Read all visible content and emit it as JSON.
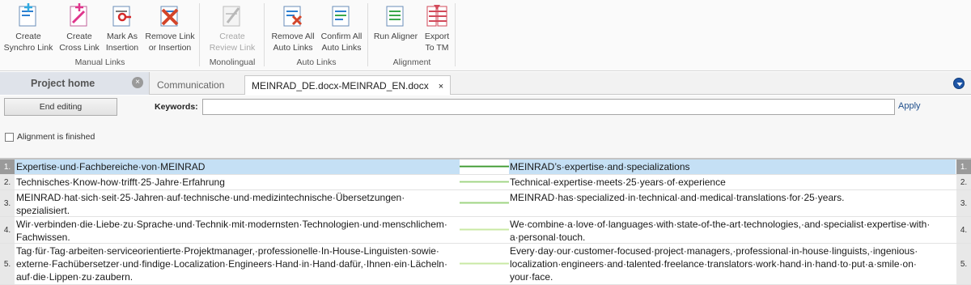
{
  "ribbon": {
    "groups": [
      {
        "label": "Manual Links",
        "buttons": [
          {
            "line1": "Create",
            "line2": "Synchro Link",
            "icon": "create-synchro-link-icon"
          },
          {
            "line1": "Create",
            "line2": "Cross Link",
            "icon": "create-cross-link-icon"
          },
          {
            "line1": "Mark As",
            "line2": "Insertion",
            "icon": "mark-as-insertion-icon"
          },
          {
            "line1": "Remove Link",
            "line2": "or Insertion",
            "icon": "remove-link-icon"
          }
        ]
      },
      {
        "label": "Monolingual",
        "buttons": [
          {
            "line1": "Create",
            "line2": "Review Link",
            "icon": "create-review-link-icon",
            "disabled": true
          }
        ]
      },
      {
        "label": "Auto Links",
        "buttons": [
          {
            "line1": "Remove All",
            "line2": "Auto Links",
            "icon": "remove-all-auto-links-icon"
          },
          {
            "line1": "Confirm All",
            "line2": "Auto Links",
            "icon": "confirm-all-auto-links-icon"
          }
        ]
      },
      {
        "label": "Alignment",
        "buttons": [
          {
            "line1": "Run Aligner",
            "line2": "",
            "icon": "run-aligner-icon"
          },
          {
            "line1": "Export",
            "line2": "To TM",
            "icon": "export-to-tm-icon"
          }
        ]
      }
    ]
  },
  "tabs": {
    "home": "Project home",
    "communication": "Communication",
    "active_doc": "MEINRAD_DE.docx-MEINRAD_EN.docx",
    "close_glyph": "×"
  },
  "toolbar": {
    "end_editing": "End editing",
    "keywords_label": "Keywords:",
    "keywords_value": "",
    "apply": "Apply",
    "alignment_finished": "Alignment is finished"
  },
  "segments": [
    {
      "n": "1.",
      "source": "Expertise·und·Fachbereiche·von·MEINRAD",
      "target": "MEINRAD’s·expertise·and·specializations",
      "selected": true
    },
    {
      "n": "2.",
      "source": "Technisches·Know-how·trifft·25·Jahre·Erfahrung",
      "target": "Technical·expertise·meets·25·years·of·experience"
    },
    {
      "n": "3.",
      "source": "MEINRAD·hat·sich·seit·25·Jahren·auf·technische·und·medizintechnische·Übersetzungen· spezialisiert.",
      "target": "MEINRAD·has·specialized·in·technical·and·medical·translations·for·25·years."
    },
    {
      "n": "4.",
      "source": "Wir·verbinden·die·Liebe·zu·Sprache·und·Technik·mit·modernsten·Technologien·und·menschlichem· Fachwissen.",
      "target": "We·combine·a·love·of·languages·with·state-of-the-art·technologies,·and·specialist·expertise·with· a·personal·touch."
    },
    {
      "n": "5.",
      "source": "Tag·für·Tag·arbeiten·serviceorientierte·Projektmanager,·professionelle·In-House-Linguisten·sowie· externe·Fachübersetzer·und·findige·Localization·Engineers·Hand·in·Hand·dafür,·Ihnen·ein·Lächeln· auf·die·Lippen·zu·zaubern.",
      "target": "Every·day·our·customer-focused·project·managers,·professional·in-house·linguists,·ingenious· localization·engineers·and·talented·freelance·translators·work·hand·in·hand·to·put·a·smile·on· your·face."
    }
  ],
  "colors": {
    "selected_row": "#c5e0f5",
    "link_dark": "#3d9a2f",
    "link_light": "#9fd483",
    "link_pale": "#c9e9a4"
  }
}
